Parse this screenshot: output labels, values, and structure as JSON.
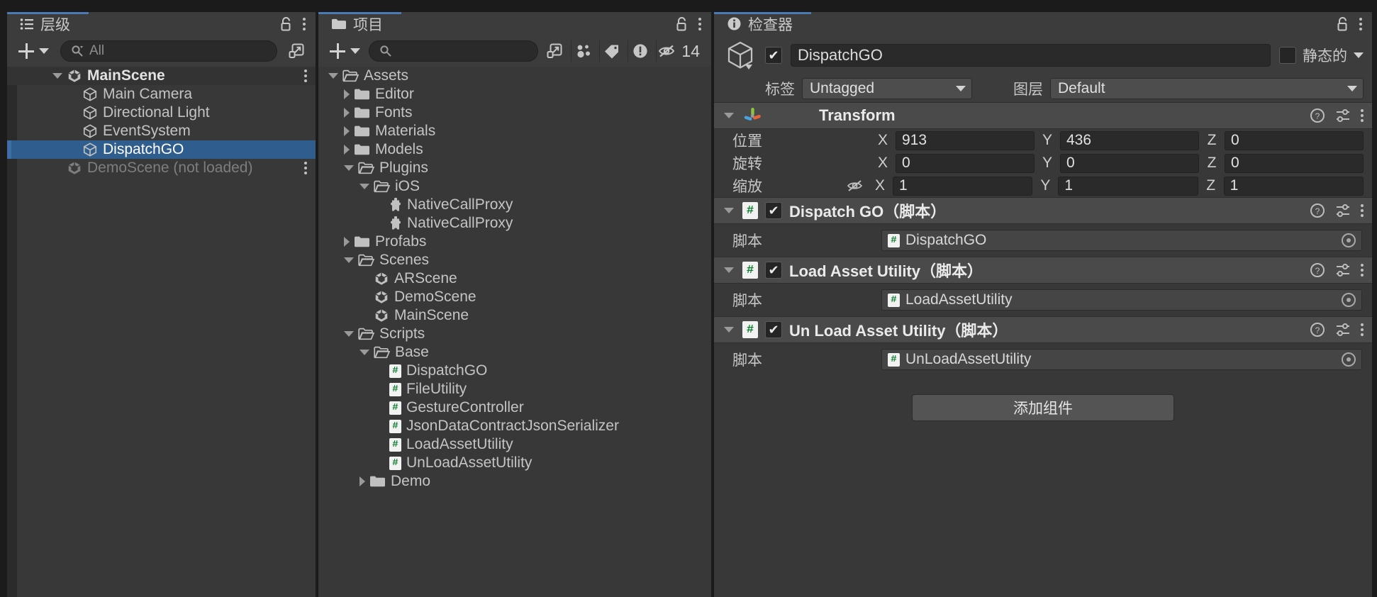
{
  "hierarchy": {
    "tab_label": "层级",
    "tab_icon": "hierarchy-icon",
    "lock_icon": "lock-open-icon",
    "menu_icon": "kebab-menu-icon",
    "add_label": "+",
    "search_placeholder": "All",
    "search_value": "",
    "expand_icon": "open-external-icon",
    "rows": [
      {
        "label": "MainScene",
        "icon": "unity-scene-icon",
        "indent": 0,
        "arrow": "expanded",
        "type": "scene",
        "menu": "⋮"
      },
      {
        "label": "Main Camera",
        "icon": "gameobject-cube-icon",
        "indent": 1,
        "arrow": "none",
        "type": "object"
      },
      {
        "label": "Directional Light",
        "icon": "gameobject-cube-icon",
        "indent": 1,
        "arrow": "none",
        "type": "object"
      },
      {
        "label": "EventSystem",
        "icon": "gameobject-cube-icon",
        "indent": 1,
        "arrow": "none",
        "type": "object"
      },
      {
        "label": "DispatchGO",
        "icon": "gameobject-cube-icon",
        "indent": 1,
        "arrow": "none",
        "type": "object",
        "selected": true
      },
      {
        "label": "DemoScene (not loaded)",
        "icon": "unity-scene-icon",
        "indent": 0,
        "arrow": "none",
        "type": "scene-unloaded",
        "dim": true,
        "menu": "⋮"
      }
    ]
  },
  "project": {
    "tab_label": "项目",
    "tab_icon": "folder-icon",
    "lock_icon": "lock-open-icon",
    "menu_icon": "kebab-menu-icon",
    "add_label": "+",
    "search_placeholder": "",
    "search_value": "",
    "expand_icon": "open-external-icon",
    "filters": [
      {
        "name": "prefab-filter-icon",
        "label": ""
      },
      {
        "name": "label-filter-icon",
        "label": ""
      },
      {
        "name": "warning-filter-icon",
        "label": ""
      }
    ],
    "hidden_count": "14",
    "hidden_icon": "eye-slash-icon",
    "rows": [
      {
        "label": "Assets",
        "icon": "folder-open-icon",
        "indent": 0,
        "arrow": "expanded"
      },
      {
        "label": "Editor",
        "icon": "folder-icon",
        "indent": 1,
        "arrow": "collapsed"
      },
      {
        "label": "Fonts",
        "icon": "folder-icon",
        "indent": 1,
        "arrow": "collapsed"
      },
      {
        "label": "Materials",
        "icon": "folder-icon",
        "indent": 1,
        "arrow": "collapsed"
      },
      {
        "label": "Models",
        "icon": "folder-icon",
        "indent": 1,
        "arrow": "collapsed"
      },
      {
        "label": "Plugins",
        "icon": "folder-open-icon",
        "indent": 1,
        "arrow": "expanded"
      },
      {
        "label": "iOS",
        "icon": "folder-open-icon",
        "indent": 2,
        "arrow": "expanded"
      },
      {
        "label": "NativeCallProxy",
        "icon": "plugin-puzzle-icon",
        "indent": 3,
        "arrow": "none"
      },
      {
        "label": "NativeCallProxy",
        "icon": "plugin-puzzle-icon",
        "indent": 3,
        "arrow": "none"
      },
      {
        "label": "Profabs",
        "icon": "folder-icon",
        "indent": 1,
        "arrow": "collapsed"
      },
      {
        "label": "Scenes",
        "icon": "folder-open-icon",
        "indent": 1,
        "arrow": "expanded"
      },
      {
        "label": "ARScene",
        "icon": "unity-scene-icon",
        "indent": 2,
        "arrow": "none"
      },
      {
        "label": "DemoScene",
        "icon": "unity-scene-icon",
        "indent": 2,
        "arrow": "none"
      },
      {
        "label": "MainScene",
        "icon": "unity-scene-icon",
        "indent": 2,
        "arrow": "none"
      },
      {
        "label": "Scripts",
        "icon": "folder-open-icon",
        "indent": 1,
        "arrow": "expanded"
      },
      {
        "label": "Base",
        "icon": "folder-open-icon",
        "indent": 2,
        "arrow": "expanded"
      },
      {
        "label": "DispatchGO",
        "icon": "csharp-script-icon",
        "indent": 3,
        "arrow": "none"
      },
      {
        "label": "FileUtility",
        "icon": "csharp-script-icon",
        "indent": 3,
        "arrow": "none"
      },
      {
        "label": "GestureController",
        "icon": "csharp-script-icon",
        "indent": 3,
        "arrow": "none"
      },
      {
        "label": "JsonDataContractJsonSerializer",
        "icon": "csharp-script-icon",
        "indent": 3,
        "arrow": "none"
      },
      {
        "label": "LoadAssetUtility",
        "icon": "csharp-script-icon",
        "indent": 3,
        "arrow": "none"
      },
      {
        "label": "UnLoadAssetUtility",
        "icon": "csharp-script-icon",
        "indent": 3,
        "arrow": "none"
      },
      {
        "label": "Demo",
        "icon": "folder-icon",
        "indent": 2,
        "arrow": "collapsed"
      }
    ]
  },
  "inspector": {
    "tab_label": "检查器",
    "tab_icon": "info-circle-icon",
    "lock_icon": "lock-open-icon",
    "menu_icon": "kebab-menu-icon",
    "object_icon": "gameobject-cube-icon",
    "object_enabled": true,
    "object_name": "DispatchGO",
    "static_checked": false,
    "static_label": "静态的",
    "tag_label": "标签",
    "tag_value": "Untagged",
    "layer_label": "图层",
    "layer_value": "Default",
    "transform": {
      "title": "Transform",
      "icon": "transform-gizmo-icon",
      "expanded": true,
      "help_icon": "help-circle-icon",
      "preset_icon": "preset-sliders-icon",
      "menu_icon": "kebab-menu-icon",
      "rows": [
        {
          "label": "位置",
          "x": "913",
          "y": "436",
          "z": "0",
          "link": false
        },
        {
          "label": "旋转",
          "x": "0",
          "y": "0",
          "z": "0",
          "link": false
        },
        {
          "label": "缩放",
          "x": "1",
          "y": "1",
          "z": "1",
          "link": true,
          "link_icon": "link-broken-icon"
        }
      ],
      "axes": [
        "X",
        "Y",
        "Z"
      ]
    },
    "components": [
      {
        "title": "Dispatch GO",
        "suffix": "（脚本）",
        "icon": "csharp-script-icon",
        "enabled": true,
        "expanded": true,
        "field_label": "脚本",
        "field_value": "DispatchGO",
        "field_icon": "csharp-script-icon",
        "picker_icon": "object-picker-icon",
        "help_icon": "help-circle-icon",
        "preset_icon": "preset-sliders-icon",
        "menu_icon": "kebab-menu-icon"
      },
      {
        "title": "Load Asset Utility",
        "suffix": "（脚本）",
        "icon": "csharp-script-icon",
        "enabled": true,
        "expanded": true,
        "field_label": "脚本",
        "field_value": "LoadAssetUtility",
        "field_icon": "csharp-script-icon",
        "picker_icon": "object-picker-icon",
        "help_icon": "help-circle-icon",
        "preset_icon": "preset-sliders-icon",
        "menu_icon": "kebab-menu-icon"
      },
      {
        "title": "Un Load Asset Utility",
        "suffix": "（脚本）",
        "icon": "csharp-script-icon",
        "enabled": true,
        "expanded": true,
        "field_label": "脚本",
        "field_value": "UnLoadAssetUtility",
        "field_icon": "csharp-script-icon",
        "picker_icon": "object-picker-icon",
        "help_icon": "help-circle-icon",
        "preset_icon": "preset-sliders-icon",
        "menu_icon": "kebab-menu-icon"
      }
    ],
    "add_component_label": "添加组件"
  },
  "colors": {
    "selection_blue": "#2f5e8e",
    "tab_accent": "#4b7bb5",
    "panel_bg": "#383838",
    "header_bg": "#3c3c3c",
    "component_header": "#4a4a4a",
    "script_green": "#0a7d2c",
    "axis_green": "#8cc63f",
    "axis_blue": "#4aa3dd",
    "axis_orange": "#e8623a"
  }
}
